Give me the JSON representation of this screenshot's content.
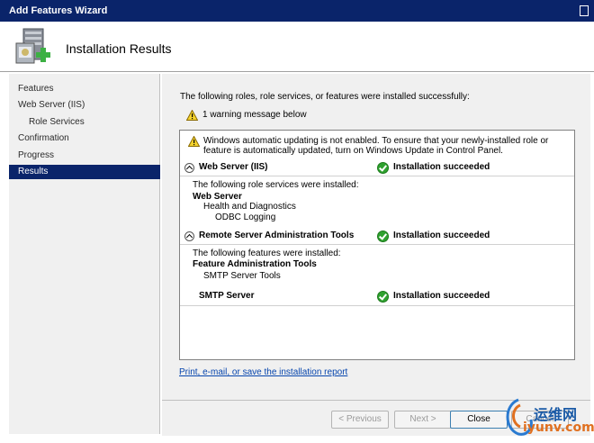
{
  "window": {
    "title": "Add Features Wizard"
  },
  "header": {
    "page_title": "Installation Results"
  },
  "sidebar": {
    "items": [
      {
        "label": "Features",
        "level": "top",
        "active": false
      },
      {
        "label": "Web Server (IIS)",
        "level": "top",
        "active": false
      },
      {
        "label": "Role Services",
        "level": "sub",
        "active": false
      },
      {
        "label": "Confirmation",
        "level": "top",
        "active": false
      },
      {
        "label": "Progress",
        "level": "top",
        "active": false
      },
      {
        "label": "Results",
        "level": "top",
        "active": true
      }
    ]
  },
  "main": {
    "intro": "The following roles, role services, or features were installed successfully:",
    "warning_count": "1 warning message below",
    "warning_message": "Windows automatic updating is not enabled. To ensure that your newly-installed role or feature is automatically updated, turn on Windows Update in Control Panel.",
    "sections": [
      {
        "title": "Web Server (IIS)",
        "status": "Installation succeeded",
        "lines": [
          {
            "text": "The following role services were installed:",
            "style": "normal"
          },
          {
            "text": "Web Server",
            "style": "bold"
          },
          {
            "text": "Health and Diagnostics",
            "style": "indent1"
          },
          {
            "text": "ODBC Logging",
            "style": "indent2"
          }
        ]
      },
      {
        "title": "Remote Server Administration Tools",
        "status": "Installation succeeded",
        "lines": [
          {
            "text": "The following features were installed:",
            "style": "normal"
          },
          {
            "text": "Feature Administration Tools",
            "style": "bold"
          },
          {
            "text": "SMTP Server Tools",
            "style": "indent1"
          }
        ]
      },
      {
        "title": "SMTP Server",
        "status": "Installation succeeded",
        "lines": []
      }
    ],
    "report_link": "Print, e-mail, or save the installation report"
  },
  "buttons": {
    "previous": "< Previous",
    "next": "Next >",
    "close": "Close",
    "cancel": "Cancel"
  },
  "watermark": {
    "line1": "运维网",
    "line2": "iyunv.com"
  },
  "colors": {
    "title_bar": "#0a246a",
    "selected_nav": "#0a246a",
    "success": "#2fa12f",
    "link": "#0645ad"
  },
  "icons": {
    "wizard": "server-add-icon",
    "warning": "warning-triangle-icon",
    "success": "check-circle-icon",
    "collapse": "chevron-up-circle-icon"
  }
}
